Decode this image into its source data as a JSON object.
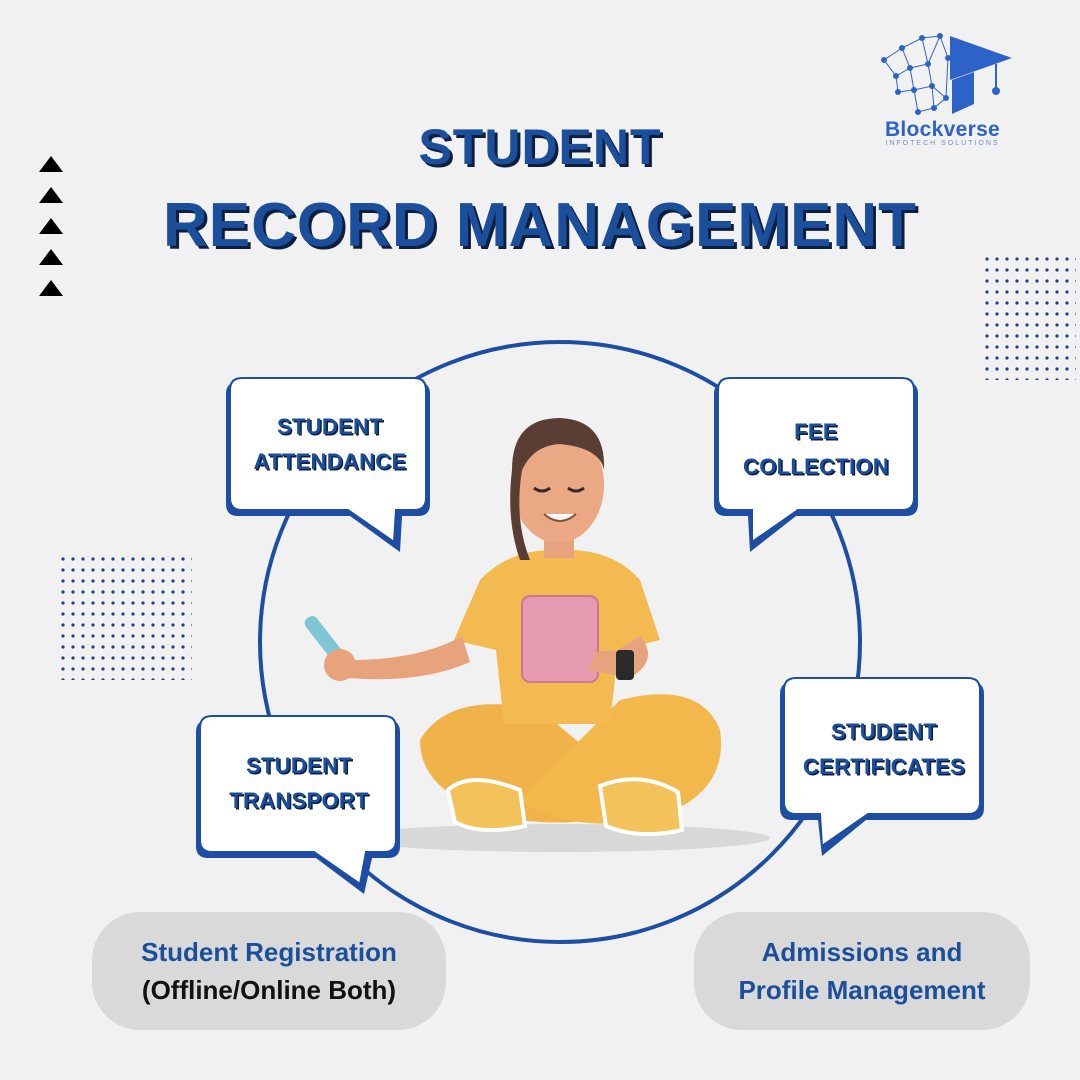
{
  "title": {
    "line1": "STUDENT",
    "line2": "RECORD MANAGEMENT"
  },
  "logo": {
    "name": "Blockverse",
    "tagline": "INFOTECH SOLUTIONS",
    "icon": "graduation-cap-network-icon"
  },
  "bubbles": {
    "attendance": {
      "line1": "STUDENT",
      "line2": "ATTENDANCE"
    },
    "fee": {
      "line1": "FEE",
      "line2": "COLLECTION"
    },
    "transport": {
      "line1": "STUDENT",
      "line2": "TRANSPORT"
    },
    "certificates": {
      "line1": "STUDENT",
      "line2": "CERTIFICATES"
    }
  },
  "pills": {
    "registration": {
      "line1": "Student Registration",
      "line2": "(Offline/Online Both)"
    },
    "admissions": {
      "line1": "Admissions and",
      "line2": "Profile Management"
    }
  },
  "colors": {
    "brand_blue": "#1b4f9c",
    "navy_shadow": "#0d1f3d",
    "ring_blue": "#1d4ea3",
    "pill_gray": "#d9d9d9",
    "background": "#f1f1f1",
    "figure_yellow": "#f2b84b",
    "tablet_pink": "#e59ab0"
  }
}
